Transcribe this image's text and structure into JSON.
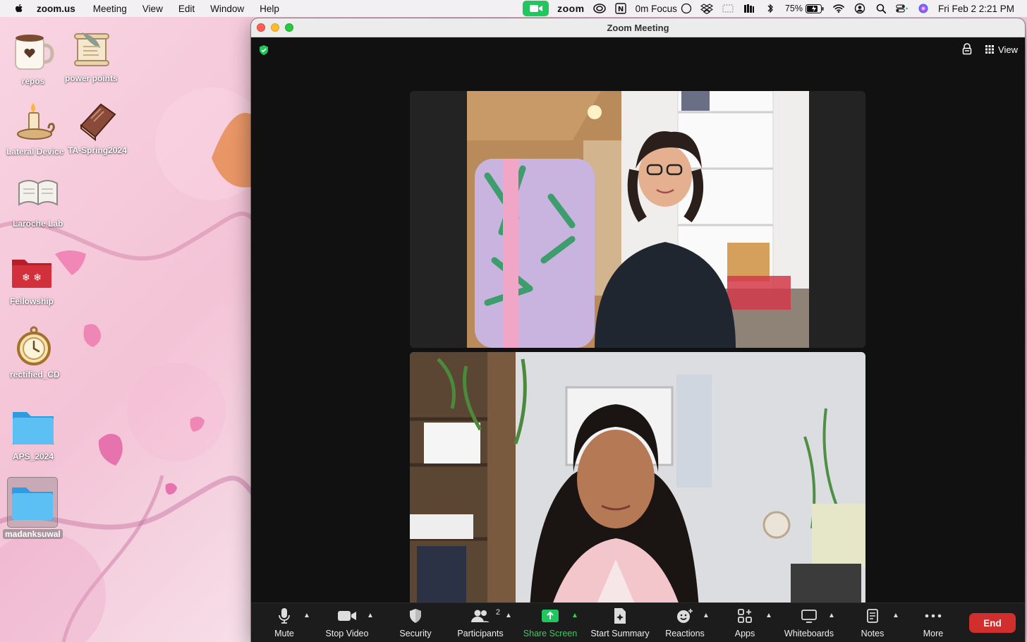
{
  "menubar": {
    "app_name": "zoom.us",
    "items": [
      "Meeting",
      "View",
      "Edit",
      "Window",
      "Help"
    ],
    "zoom_brand": "zoom",
    "focus_label": "0m Focus",
    "battery": "75%",
    "datetime": "Fri Feb 2  2:21 PM"
  },
  "desktop": {
    "icons": [
      {
        "label": "repos"
      },
      {
        "label": "power points"
      },
      {
        "label": "Lateral Device"
      },
      {
        "label": "TA-Spring2024"
      },
      {
        "label": "Laroche Lab"
      },
      {
        "label": "Fellowship"
      },
      {
        "label": "rectified_CD"
      },
      {
        "label": "APS_2024"
      },
      {
        "label": "madanksuwal"
      }
    ]
  },
  "window": {
    "title": "Zoom Meeting",
    "view_label": "View"
  },
  "toolbar": {
    "mute": "Mute",
    "stop_video": "Stop Video",
    "security": "Security",
    "participants": "Participants",
    "participants_count": "2",
    "share_screen": "Share Screen",
    "start_summary": "Start Summary",
    "reactions": "Reactions",
    "apps": "Apps",
    "whiteboards": "Whiteboards",
    "notes": "Notes",
    "more": "More",
    "end": "End"
  },
  "colors": {
    "share_green": "#35d05a",
    "end_red": "#d12e2e",
    "zoom_badge": "#22c55e"
  }
}
